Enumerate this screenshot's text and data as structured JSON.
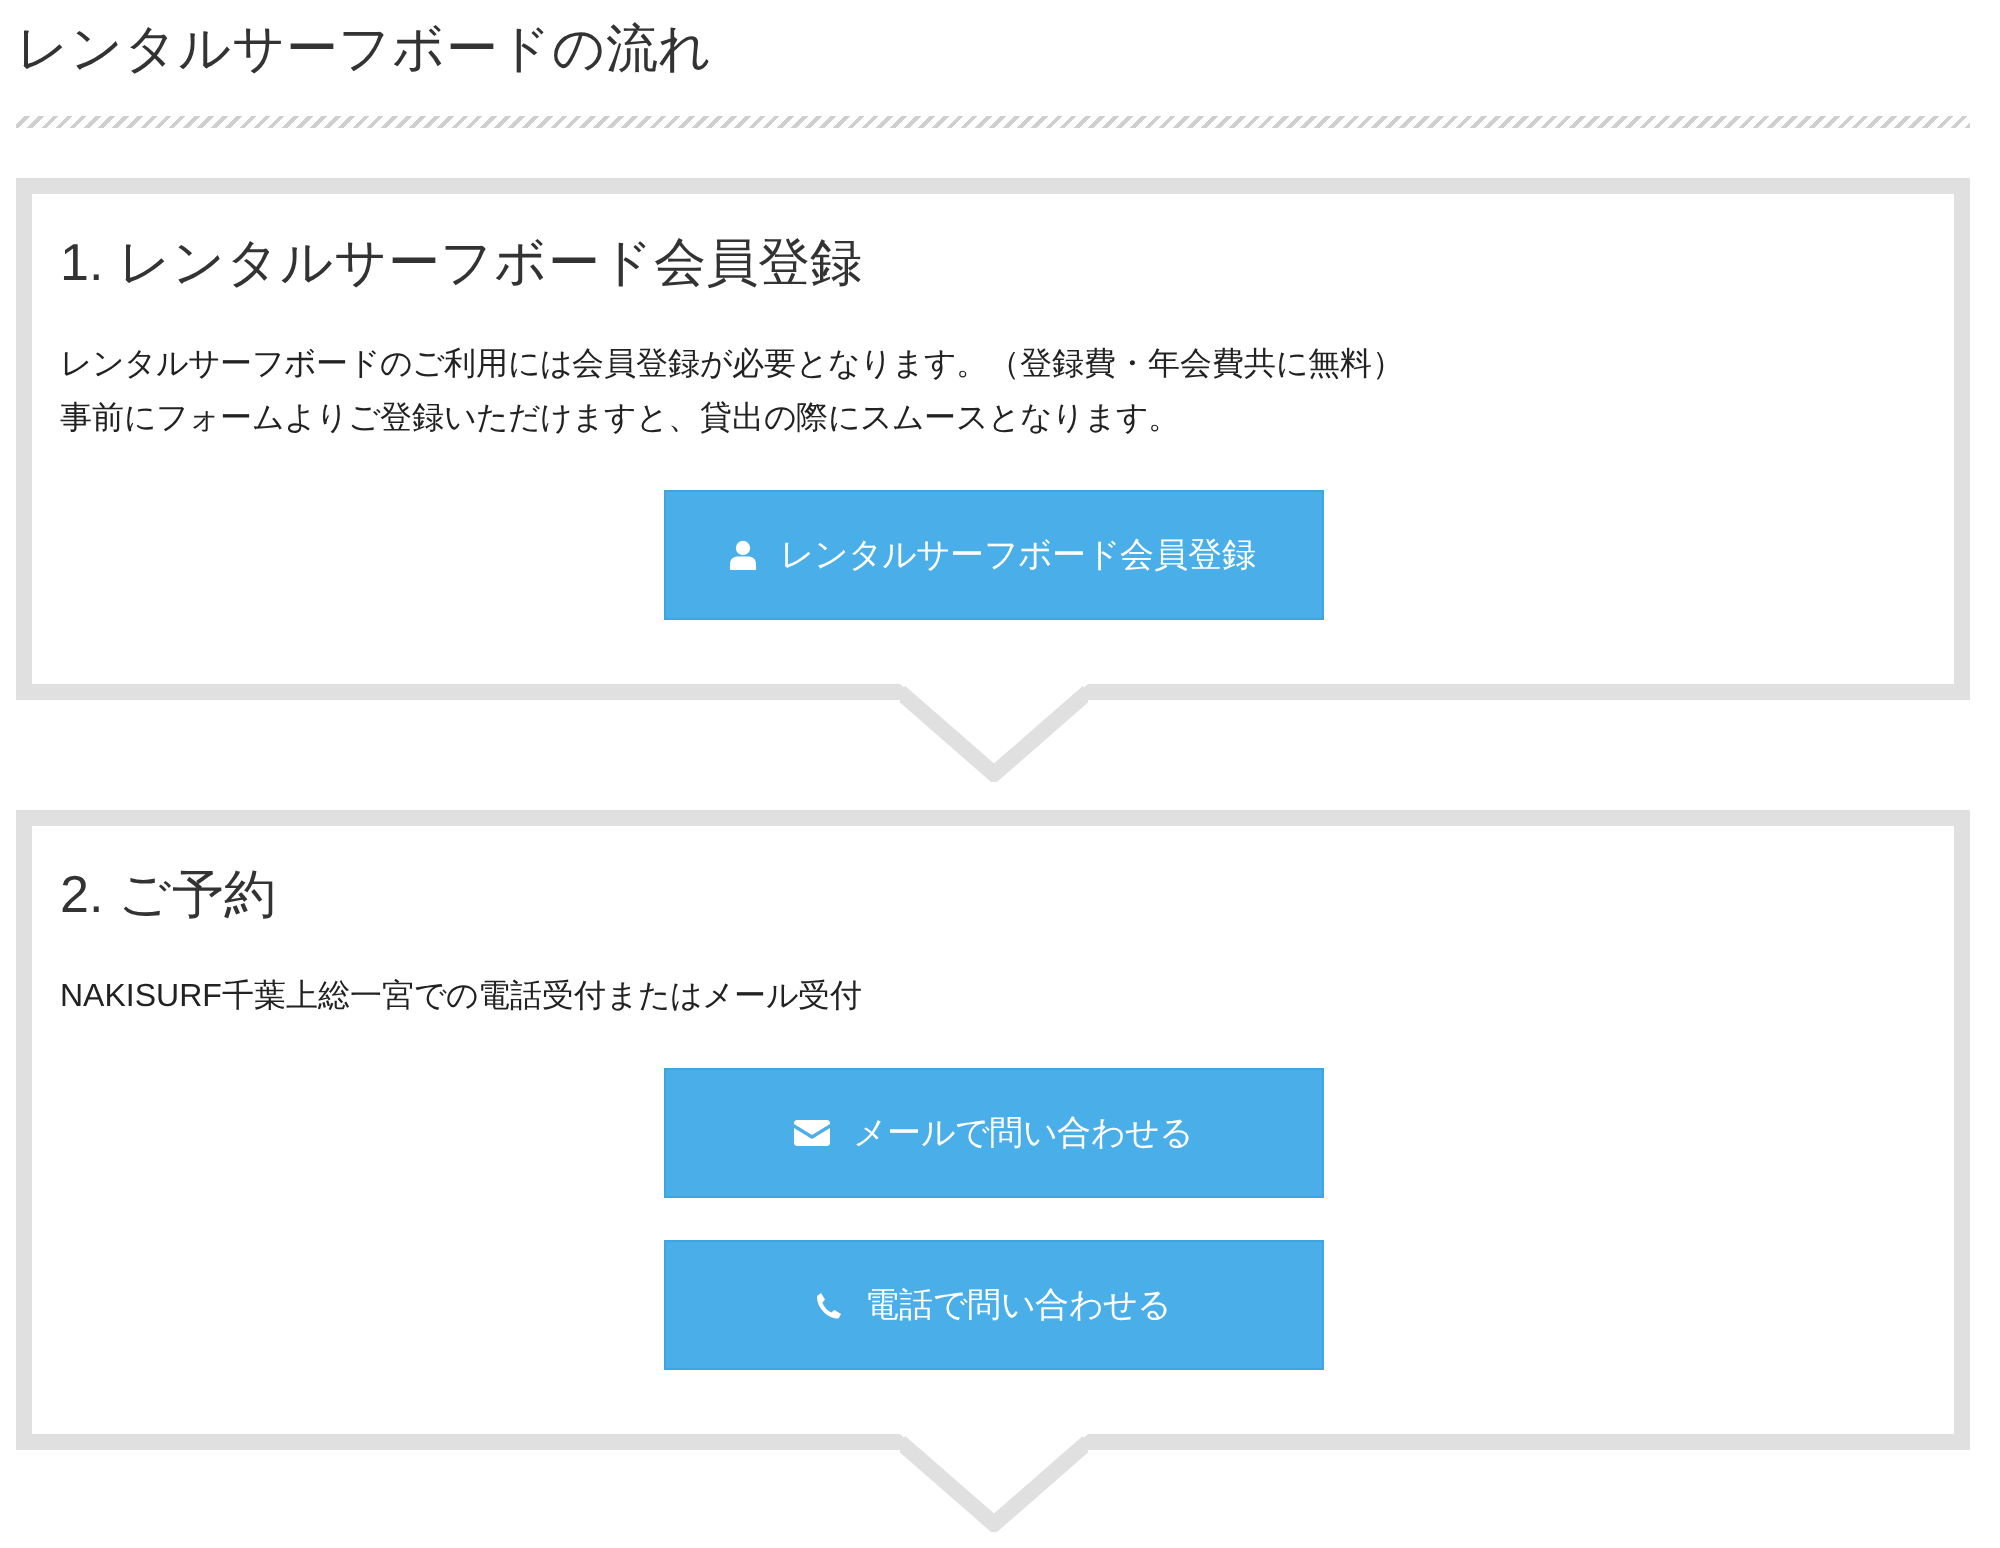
{
  "title": "レンタルサーフボードの流れ",
  "steps": [
    {
      "title": "1. レンタルサーフボード会員登録",
      "paragraphs": [
        "レンタルサーフボードのご利用には会員登録が必要となります。（登録費・年会費共に無料）",
        "事前にフォームよりご登録いただけますと、貸出の際にスムースとなります。"
      ],
      "buttons": [
        {
          "label": "レンタルサーフボード会員登録",
          "kind": "user"
        }
      ]
    },
    {
      "title": "2. ご予約",
      "paragraphs": [
        "NAKISURF千葉上総一宮での電話受付またはメール受付"
      ],
      "buttons": [
        {
          "label": "メールで問い合わせる",
          "kind": "mail"
        },
        {
          "label": "電話で問い合わせる",
          "kind": "phone"
        }
      ]
    }
  ]
}
